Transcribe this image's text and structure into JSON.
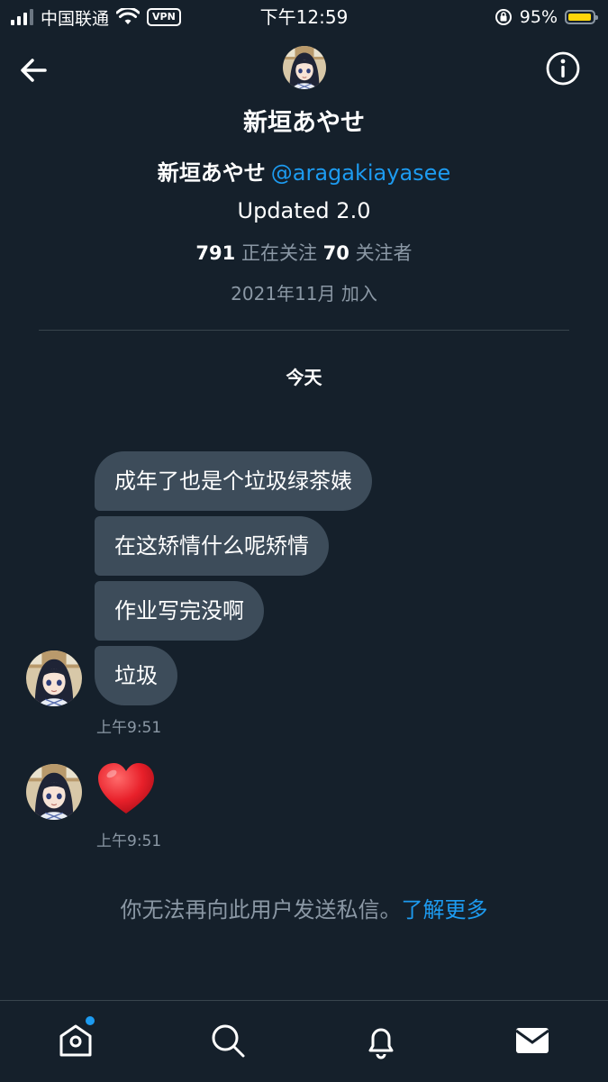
{
  "status_bar": {
    "carrier": "中国联通",
    "vpn": "VPN",
    "time": "下午12:59",
    "battery_percent": "95%",
    "battery_level": 0.95
  },
  "header": {
    "title": "新垣あやせ"
  },
  "profile": {
    "display_name": "新垣あやせ",
    "handle": "@aragakiayasee",
    "bio": "Updated 2.0",
    "following_count": "791",
    "following_label": "正在关注",
    "followers_count": "70",
    "followers_label": "关注者",
    "joined": "2021年11月 加入"
  },
  "conversation": {
    "day_label": "今天",
    "messages": [
      {
        "text": "成年了也是个垃圾绿茶婊"
      },
      {
        "text": "在这矫情什么呢矫情"
      },
      {
        "text": "作业写完没啊"
      },
      {
        "text": "垃圾"
      }
    ],
    "time_1": "上午9:51",
    "reaction_time": "上午9:51"
  },
  "notice": {
    "text": "你无法再向此用户发送私信。",
    "link": "了解更多"
  },
  "icons": {
    "back": "arrow-left-icon",
    "info": "info-icon",
    "home": "home-icon",
    "search": "search-icon",
    "notifications": "bell-icon",
    "messages": "mail-icon",
    "reaction": "heart-emoji"
  },
  "colors": {
    "background": "#15202b",
    "bubble": "#3d4c5a",
    "accent": "#1d9bf0",
    "muted": "#8b98a5",
    "heart": "#e8202a"
  }
}
